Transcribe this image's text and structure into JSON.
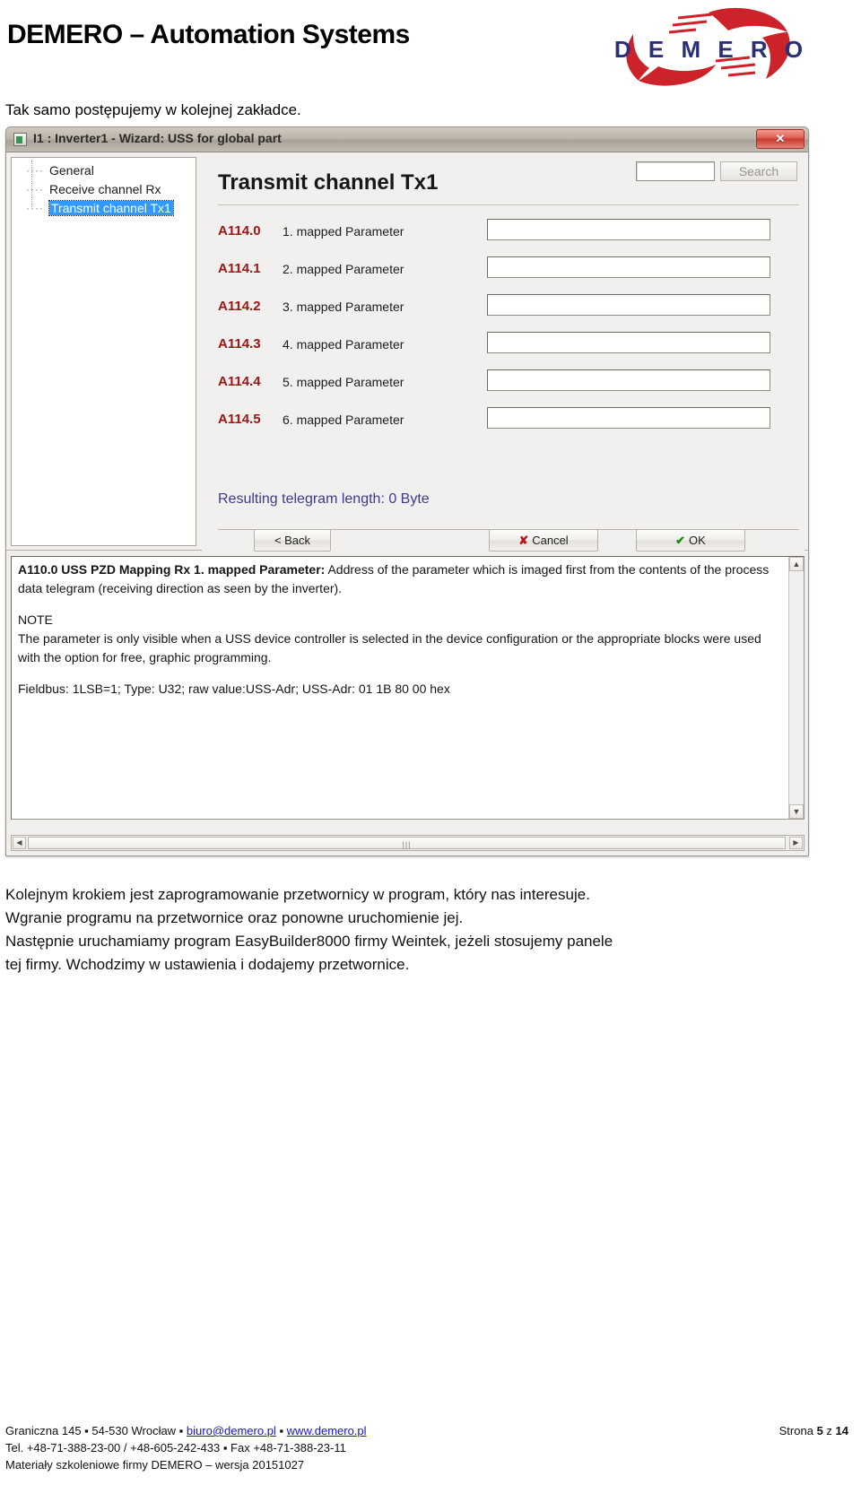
{
  "header": {
    "brand_title": "DEMERO – Automation Systems",
    "logo_text": "D E M E R O"
  },
  "intro_line": "Tak samo postępujemy w kolejnej zakładce.",
  "window": {
    "title": "I1 : Inverter1 - Wizard: USS for global part",
    "close_label": "✕",
    "tree": {
      "items": [
        {
          "label": "General",
          "selected": false
        },
        {
          "label": "Receive channel Rx",
          "selected": false
        },
        {
          "label": "Transmit channel Tx1",
          "selected": true
        }
      ]
    },
    "detail": {
      "title": "Transmit channel Tx1",
      "search_value": "",
      "search_button": "Search",
      "parameters": [
        {
          "address": "A114.0",
          "name": "1. mapped Parameter",
          "value": ""
        },
        {
          "address": "A114.1",
          "name": "2. mapped Parameter",
          "value": ""
        },
        {
          "address": "A114.2",
          "name": "3. mapped Parameter",
          "value": ""
        },
        {
          "address": "A114.3",
          "name": "4. mapped Parameter",
          "value": ""
        },
        {
          "address": "A114.4",
          "name": "5. mapped Parameter",
          "value": ""
        },
        {
          "address": "A114.5",
          "name": "6. mapped Parameter",
          "value": ""
        }
      ],
      "telegram_length": "Resulting telegram length: 0 Byte"
    },
    "buttons": {
      "back": "< Back",
      "cancel": "Cancel",
      "ok": "OK"
    },
    "help": {
      "param_heading": "A110.0  USS PZD Mapping Rx 1. mapped Parameter:",
      "param_body": " Address of the parameter which is imaged first from the contents of the process data telegram (receiving direction as seen by the inverter).",
      "note_heading": "NOTE",
      "note_body": "The parameter is only visible when a USS device controller is selected in the device configuration or the appropriate blocks were used with the option for free, graphic programming.",
      "fieldbus_line": "Fieldbus: 1LSB=1; Type: U32; raw value:USS-Adr; USS-Adr: 01 1B 80 00 hex"
    }
  },
  "body_paragraphs": [
    "Kolejnym krokiem jest zaprogramowanie przetwornicy w program, który nas interesuje.",
    "Wgranie programu na przetwornice oraz ponowne uruchomienie jej.",
    "Następnie uruchamiamy program EasyBuilder8000 firmy Weintek, jeżeli stosujemy panele",
    "tej firmy. Wchodzimy w ustawienia i dodajemy przetwornice."
  ],
  "footer": {
    "address_prefix": "Graniczna 145 ▪ 54-530 Wrocław ▪ ",
    "email": "biuro@demero.pl",
    "sep": " ▪ ",
    "website": "www.demero.pl",
    "phone_line": "Tel. +48-71-388-23-00 / +48-605-242-433 ▪ Fax +48-71-388-23-11",
    "materials_line": "Materiały szkoleniowe firmy DEMERO – wersja 20151027",
    "page_prefix": "Strona ",
    "page_number": "5",
    "page_mid": " z ",
    "page_total": "14"
  },
  "colors": {
    "address_red": "#a01414",
    "telegram_blue": "#3b3b8f",
    "selection_blue": "#3399ff",
    "link_blue": "#1515cc"
  }
}
